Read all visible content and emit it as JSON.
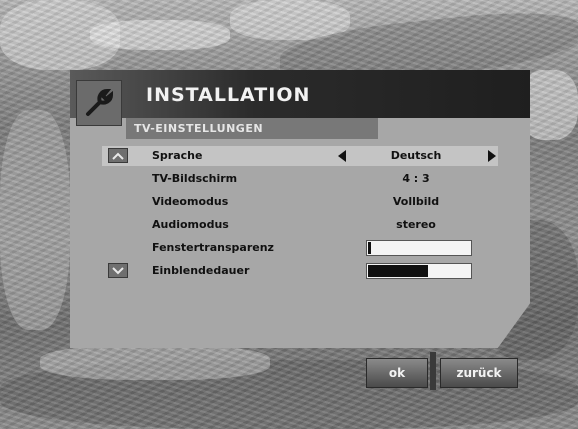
{
  "header": {
    "title": "INSTALLATION",
    "subtitle": "TV-EINSTELLUNGEN",
    "logo_icon": "wrench-icon"
  },
  "settings": [
    {
      "label": "Sprache",
      "value": "Deutsch",
      "selected": true
    },
    {
      "label": "TV-Bildschirm",
      "value": "4 : 3"
    },
    {
      "label": "Videomodus",
      "value": "Vollbild"
    },
    {
      "label": "Audiomodus",
      "value": "stereo"
    },
    {
      "label": "Fenstertransparenz",
      "value_level": 0.05
    },
    {
      "label": "Einblendedauer",
      "value_level": 0.6
    }
  ],
  "scroll": {
    "up_icon": "chevron-up-icon",
    "down_icon": "chevron-down-icon"
  },
  "buttons": {
    "ok": "ok",
    "back": "zurück"
  },
  "colors": {
    "panel": "#a7a7a7",
    "title_bar": "#1f1f1f",
    "highlight": "#c4c4c4"
  }
}
